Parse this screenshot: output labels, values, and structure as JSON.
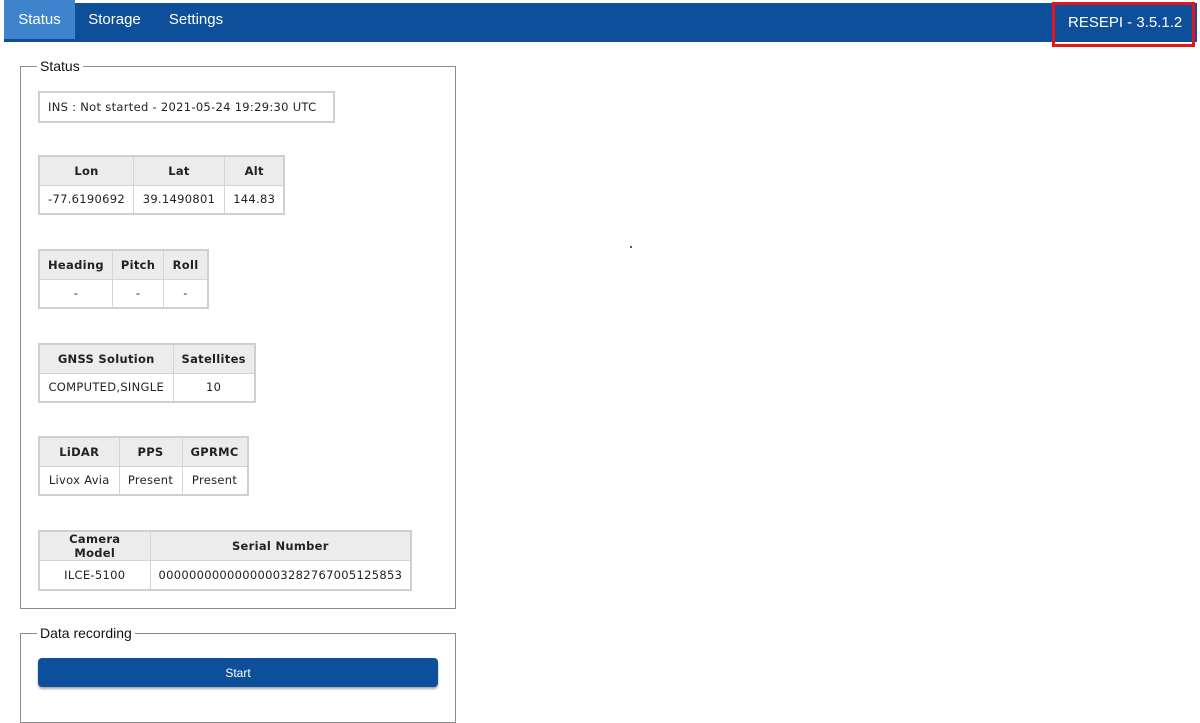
{
  "navbar": {
    "tabs": [
      {
        "label": "Status",
        "active": true
      },
      {
        "label": "Storage",
        "active": false
      },
      {
        "label": "Settings",
        "active": false
      }
    ],
    "version": "RESEPI - 3.5.1.2",
    "colors": {
      "bar": "#0d4f9b",
      "active_tab": "#3d84cc",
      "highlight": "#e8141b"
    }
  },
  "status": {
    "legend": "Status",
    "ins": "INS : Not started - 2021-05-24 19:29:30 UTC",
    "position": {
      "headers": [
        "Lon",
        "Lat",
        "Alt"
      ],
      "values": [
        "-77.6190692",
        "39.1490801",
        "144.83"
      ]
    },
    "attitude": {
      "headers": [
        "Heading",
        "Pitch",
        "Roll"
      ],
      "values": [
        "-",
        "-",
        "-"
      ]
    },
    "gnss": {
      "headers": [
        "GNSS Solution",
        "Satellites"
      ],
      "values": [
        "COMPUTED,SINGLE",
        "10"
      ]
    },
    "sensors": {
      "headers": [
        "LiDAR",
        "PPS",
        "GPRMC"
      ],
      "values": [
        "Livox Avia",
        "Present",
        "Present"
      ]
    },
    "camera": {
      "headers": [
        "Camera Model",
        "Serial Number"
      ],
      "values": [
        "ILCE-5100",
        "00000000000000003282767005125853"
      ]
    }
  },
  "recording": {
    "legend": "Data recording",
    "start_label": "Start"
  }
}
